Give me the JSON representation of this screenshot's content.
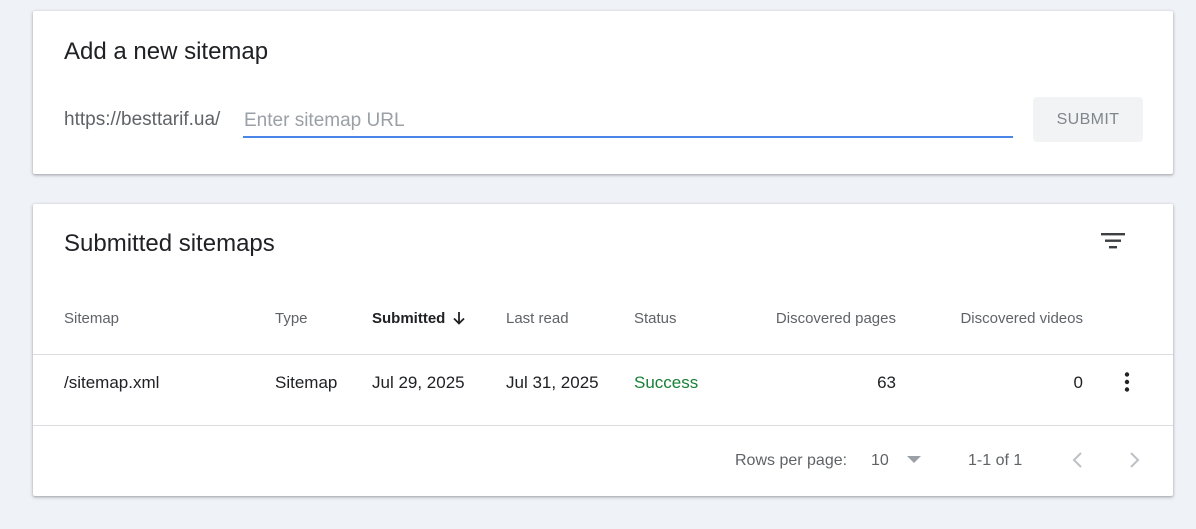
{
  "add_sitemap": {
    "title": "Add a new sitemap",
    "url_prefix": "https://besttarif.ua/",
    "input_value": "",
    "input_placeholder": "Enter sitemap URL",
    "submit_label": "SUBMIT"
  },
  "submitted": {
    "title": "Submitted sitemaps",
    "filter_icon": "filter-list-icon",
    "columns": [
      {
        "label": "Sitemap"
      },
      {
        "label": "Type"
      },
      {
        "label": "Submitted",
        "sorted": "descending"
      },
      {
        "label": "Last read"
      },
      {
        "label": "Status"
      },
      {
        "label": "Discovered pages"
      },
      {
        "label": "Discovered videos"
      }
    ],
    "rows": [
      {
        "sitemap": "/sitemap.xml",
        "type": "Sitemap",
        "submitted": "Jul 29, 2025",
        "last_read": "Jul 31, 2025",
        "status": "Success",
        "discovered_pages": "63",
        "discovered_videos": "0"
      }
    ],
    "pagination": {
      "rows_per_page_label": "Rows per page:",
      "rows_per_page": "10",
      "range": "1-1 of 1"
    }
  },
  "colors": {
    "background": "#eff2f7",
    "input_underline": "#4a86e8",
    "status_success": "#188038",
    "submit_disabled_bg": "#f1f3f4"
  }
}
